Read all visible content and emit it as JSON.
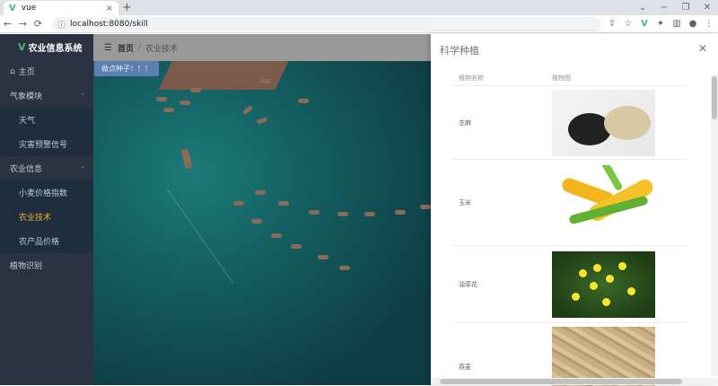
{
  "browser": {
    "tab_title": "vue",
    "favicon": "V",
    "tab_close": "×",
    "new_tab": "+",
    "url": "localhost:8080/skill",
    "window_controls": [
      "⌄",
      "−",
      "❐",
      "✕"
    ],
    "nav": {
      "back": "←",
      "forward": "→",
      "reload": "⟳"
    }
  },
  "sidebar": {
    "logo": "农业信息系统",
    "logo_mark": "V",
    "items": [
      {
        "label": "主页",
        "type": "top",
        "icon": "home-icon"
      },
      {
        "label": "气象模块",
        "type": "top",
        "arrow": "⌃"
      },
      {
        "label": "天气",
        "type": "sub"
      },
      {
        "label": "灾害预警信号",
        "type": "sub"
      },
      {
        "label": "农业信息",
        "type": "top",
        "arrow": "⌃"
      },
      {
        "label": "小麦价格指数",
        "type": "sub"
      },
      {
        "label": "农业技术",
        "type": "sub",
        "active": true
      },
      {
        "label": "农产品价格",
        "type": "sub"
      },
      {
        "label": "植物识别",
        "type": "top"
      }
    ],
    "colors": {
      "bg": "#2b3343",
      "active": "#e6b13c"
    }
  },
  "navbar": {
    "breadcrumb_home": "首页",
    "breadcrumb_sep": "/",
    "breadcrumb_current": "农业技术"
  },
  "main": {
    "grow_button": "做点种子！！！"
  },
  "drawer": {
    "title": "科学种植",
    "close": "✕",
    "columns": [
      "植物名称",
      "植物图"
    ],
    "rows": [
      {
        "name": "芝麻",
        "image": "sesame-image"
      },
      {
        "name": "玉米",
        "image": "corn-image"
      },
      {
        "name": "油菜花",
        "image": "rapeseed-flower-image"
      },
      {
        "name": "燕麦",
        "image": "oat-image"
      }
    ]
  }
}
